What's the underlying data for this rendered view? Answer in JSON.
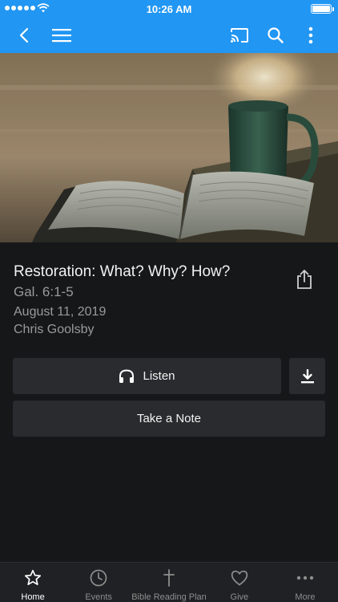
{
  "status_bar": {
    "time": "10:26 AM"
  },
  "sermon": {
    "title": "Restoration: What? Why? How?",
    "passage": "Gal. 6:1-5",
    "date": "August 11, 2019",
    "speaker": "Chris Goolsby"
  },
  "actions": {
    "listen_label": "Listen",
    "note_label": "Take a Note"
  },
  "tabs": [
    {
      "label": "Home",
      "icon": "star-icon",
      "active": true
    },
    {
      "label": "Events",
      "icon": "clock-icon",
      "active": false
    },
    {
      "label": "Bible Reading Plan",
      "icon": "cross-icon",
      "active": false
    },
    {
      "label": "Give",
      "icon": "heart-icon",
      "active": false
    },
    {
      "label": "More",
      "icon": "more-dots-icon",
      "active": false
    }
  ],
  "colors": {
    "app_bar": "#2196f3",
    "background": "#161719",
    "button": "#2a2b2e",
    "tab_bar": "#202124"
  }
}
